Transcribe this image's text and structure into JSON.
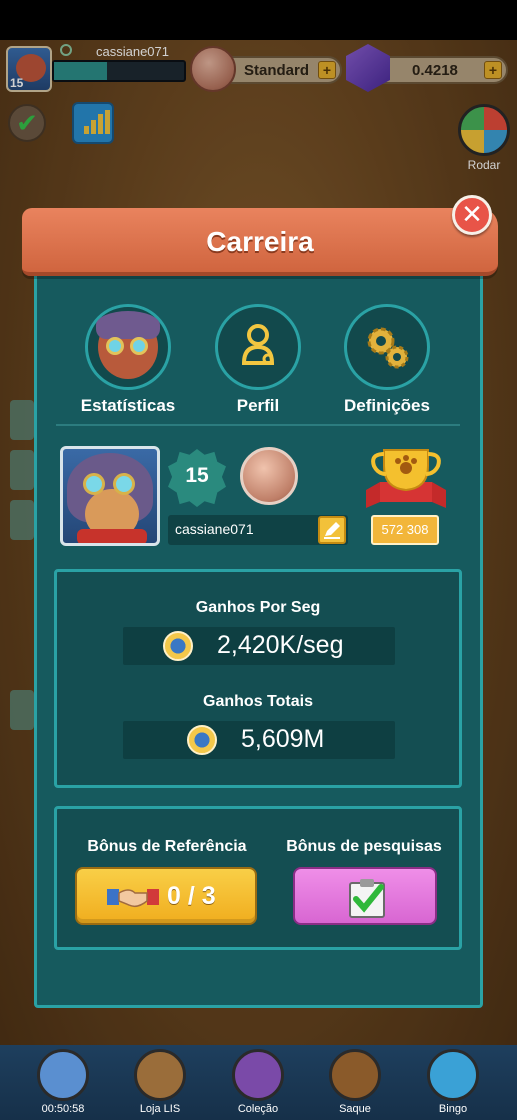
{
  "hud": {
    "username": "cassiane071",
    "level": "15",
    "xp_progress": 0.41,
    "currency_label": "Standard",
    "crypto_balance": "0.4218"
  },
  "side": {
    "wheel_label": "Rodar"
  },
  "modal": {
    "title": "Carreira",
    "tabs": [
      {
        "label": "Estatísticas"
      },
      {
        "label": "Perfil"
      },
      {
        "label": "Definições"
      }
    ],
    "profile": {
      "level": "15",
      "username": "cassiane071",
      "trophy_score": "572 308"
    },
    "earnings": {
      "per_sec_label": "Ganhos Por Seg",
      "per_sec_value": "2,420K/seg",
      "total_label": "Ganhos Totais",
      "total_value": "5,609M"
    },
    "bonus": {
      "referral_label": "Bônus de Referência",
      "referral_value": "0 / 3",
      "survey_label": "Bônus de pesquisas"
    }
  },
  "bottom_nav": [
    {
      "label": "00:50:58"
    },
    {
      "label": "Loja LIS"
    },
    {
      "label": "Coleção"
    },
    {
      "label": "Saque"
    },
    {
      "label": "Bingo"
    }
  ],
  "colors": {
    "panel_bg": "#165a5e",
    "panel_border": "#2aa2a5",
    "header": "#e07650",
    "accent_yellow": "#f2c13a",
    "survey_pink": "#e27bdc"
  }
}
